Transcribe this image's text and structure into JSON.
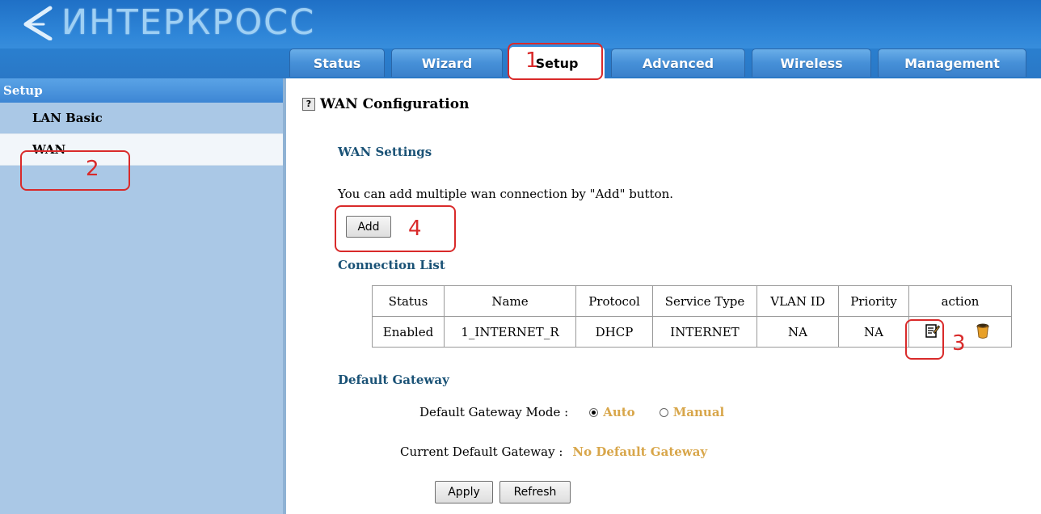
{
  "brand": {
    "logo_text": "ИНТЕРКРОСС"
  },
  "tabs": [
    {
      "label": "Status"
    },
    {
      "label": "Wizard"
    },
    {
      "label": "Setup"
    },
    {
      "label": "Advanced"
    },
    {
      "label": "Wireless"
    },
    {
      "label": "Management"
    }
  ],
  "sidebar": {
    "heading": "Setup",
    "items": [
      {
        "label": "LAN Basic"
      },
      {
        "label": "WAN"
      }
    ]
  },
  "page": {
    "title": "WAN Configuration",
    "help_icon": "?",
    "wan_settings": {
      "title": "WAN Settings",
      "description": "You can add multiple wan connection by \"Add\" button.",
      "add_label": "Add"
    },
    "connection_list": {
      "title": "Connection List",
      "columns": [
        "Status",
        "Name",
        "Protocol",
        "Service Type",
        "VLAN ID",
        "Priority",
        "action"
      ],
      "rows": [
        {
          "status": "Enabled",
          "name": "1_INTERNET_R",
          "protocol": "DHCP",
          "service_type": "INTERNET",
          "vlan_id": "NA",
          "priority": "NA"
        }
      ]
    },
    "default_gateway": {
      "title": "Default Gateway",
      "mode_label": "Default Gateway Mode :",
      "mode_options": [
        "Auto",
        "Manual"
      ],
      "mode_selected": "Auto",
      "current_label": "Current Default Gateway :",
      "current_value": "No Default Gateway"
    },
    "buttons": {
      "apply": "Apply",
      "refresh": "Refresh"
    }
  },
  "annotations": [
    "1",
    "2",
    "3",
    "4"
  ],
  "icons": {
    "edit": "edit-icon",
    "delete": "trash-icon",
    "help": "help-icon"
  },
  "colors": {
    "header_blue": "#2a7fcf",
    "sidebar_bg": "#aac8e6",
    "section_title": "#1a5276",
    "highlight_gold": "#d8a64a",
    "annotation_red": "#d92a2a"
  }
}
